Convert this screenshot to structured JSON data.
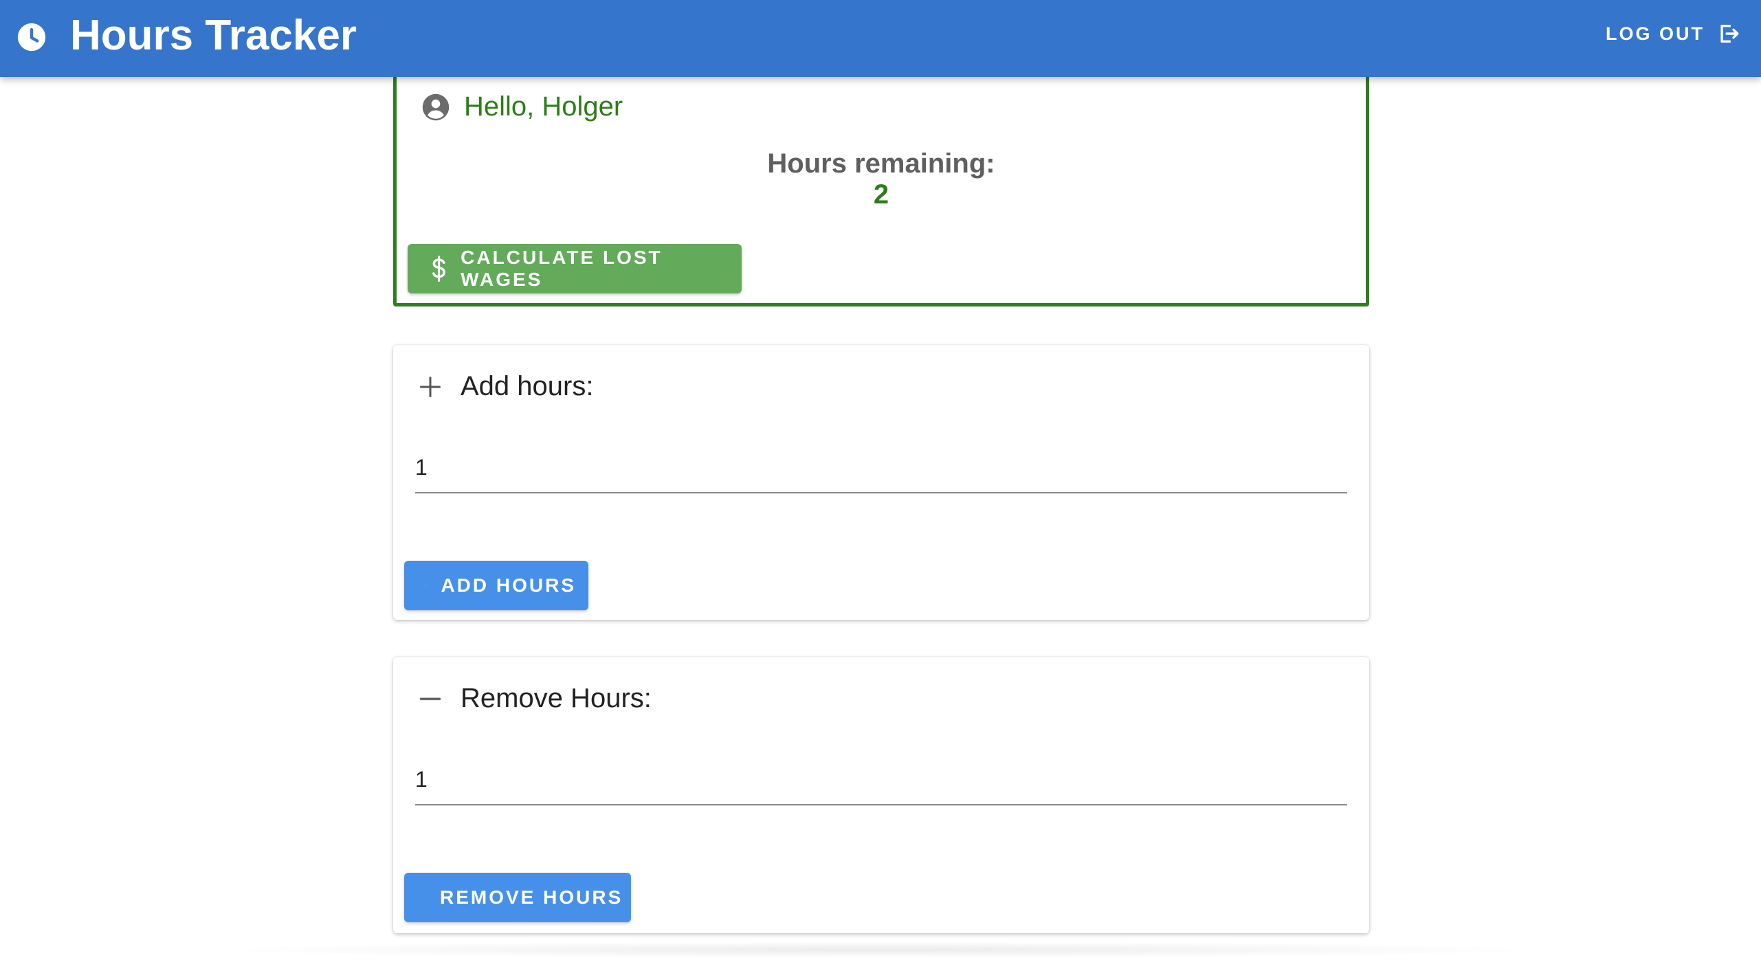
{
  "appbar": {
    "title": "Hours Tracker",
    "icon": "clock-icon",
    "logout_label": "LOG OUT",
    "logout_icon": "logout-icon",
    "color": "#3575CB"
  },
  "greeting": {
    "text": "Hello, Holger",
    "icon": "account-circle-icon",
    "remaining_label": "Hours remaining:",
    "remaining_value": "2",
    "calculate_label": "CALCULATE LOST WAGES",
    "calculate_icon": "dollar-icon",
    "accent_color": "#2E7D18",
    "button_color": "#63AA5A"
  },
  "add_card": {
    "title": "Add hours:",
    "icon": "plus-icon",
    "input_value": "1",
    "button_label": "ADD HOURS",
    "button_icon": "plus-icon",
    "button_color": "#4790EA"
  },
  "remove_card": {
    "title": "Remove Hours:",
    "icon": "minus-icon",
    "input_value": "1",
    "button_label": "REMOVE HOURS",
    "button_icon": "minus-icon",
    "button_color": "#4790EA"
  }
}
